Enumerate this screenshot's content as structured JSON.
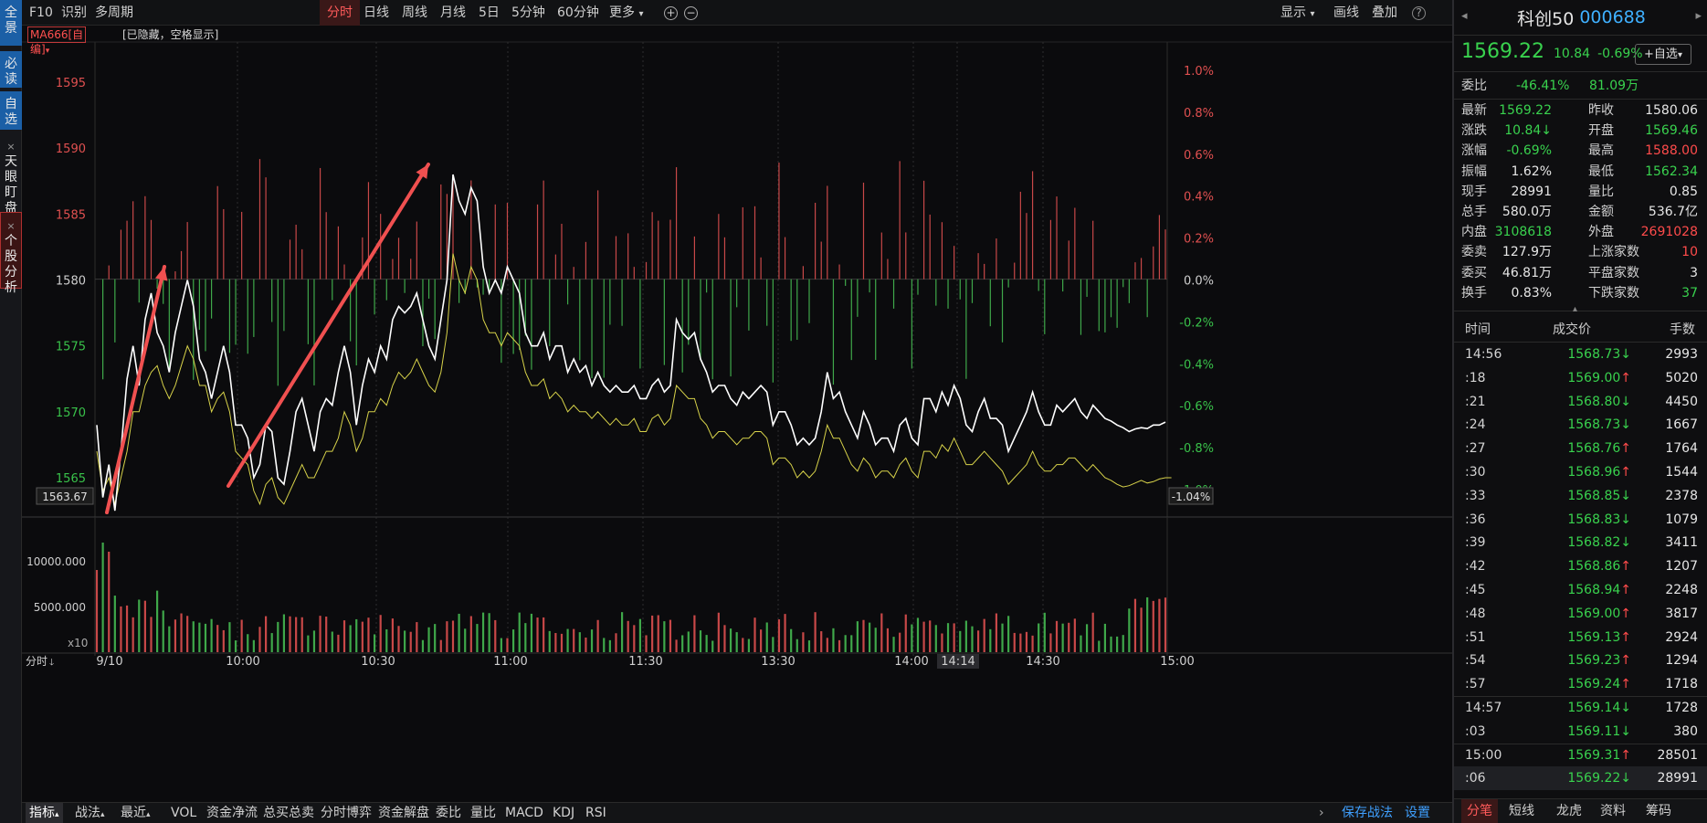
{
  "left_tabs": [
    {
      "label": "全景",
      "style": "blue"
    },
    {
      "label": "必读",
      "style": "blue"
    },
    {
      "label": "自选",
      "style": "blue"
    },
    {
      "label": "天眼盯盘",
      "style": "plain",
      "close": "×"
    },
    {
      "label": "个股分析",
      "style": "red",
      "close": "×"
    }
  ],
  "toolbar": {
    "f10": "F10",
    "identify": "识别",
    "multi_period": "多周期",
    "periods": [
      "分时",
      "日线",
      "周线",
      "月线",
      "5日",
      "5分钟",
      "60分钟"
    ],
    "more": "更多",
    "more_arrow": "▾",
    "zoom_in": "+",
    "zoom_out": "−",
    "display": "显示",
    "display_arrow": "▾",
    "draw_line": "画线",
    "overlay": "叠加",
    "help": "?"
  },
  "ma_bar": {
    "button": "MA666[自编]",
    "button_arrow": "▾",
    "hint": "[已隐藏，空格显示]"
  },
  "chart_data": {
    "type": "line",
    "yticks_price": [
      1595,
      1590,
      1585,
      1580,
      1575,
      1570,
      1565
    ],
    "yticks_pct": [
      "1.0%",
      "0.8%",
      "0.6%",
      "0.4%",
      "0.2%",
      "0.0%",
      "-0.2%",
      "-0.4%",
      "-0.6%",
      "-0.8%",
      "-1.0%"
    ],
    "price_cursor": "1563.67",
    "pct_cursor": "-1.04%",
    "xticks": [
      "9/10",
      "10:00",
      "10:30",
      "11:00",
      "11:30",
      "13:30",
      "14:00",
      "14:14",
      "14:30",
      "15:00"
    ],
    "volume_yticks": [
      "10000.000",
      "5000.000"
    ],
    "volume_unit": "x10",
    "period_label": "分时",
    "period_arrow": "🡓",
    "price_line": [
      1569,
      1563.5,
      1566,
      1562.5,
      1567,
      1572.5,
      1575,
      1572,
      1577,
      1579,
      1576,
      1575,
      1573,
      1576,
      1578,
      1580,
      1578,
      1574,
      1573,
      1571,
      1573,
      1575,
      1573,
      1569,
      1569,
      1568,
      1565,
      1566,
      1569,
      1568.5,
      1565,
      1564.5,
      1567,
      1570,
      1571,
      1569,
      1567,
      1570,
      1571,
      1570.5,
      1573,
      1575,
      1573,
      1569,
      1572,
      1574,
      1573,
      1575,
      1574,
      1577,
      1578,
      1577.5,
      1578,
      1579,
      1577,
      1575,
      1574,
      1577,
      1580,
      1588,
      1586,
      1585,
      1587,
      1586,
      1581,
      1579,
      1580,
      1579,
      1581,
      1580,
      1579,
      1576,
      1575,
      1575,
      1576,
      1574,
      1575,
      1575,
      1573,
      1574,
      1573,
      1573.5,
      1572,
      1573,
      1572,
      1571.5,
      1572,
      1571.5,
      1571.5,
      1572,
      1571,
      1571,
      1572,
      1572.5,
      1571.5,
      1572,
      1577,
      1576,
      1575.5,
      1576,
      1574,
      1573,
      1571.5,
      1572,
      1572,
      1571,
      1570.5,
      1571.5,
      1571,
      1571.5,
      1572,
      1571.5,
      1569,
      1570,
      1570,
      1569,
      1567.5,
      1568,
      1567.5,
      1568,
      1570,
      1573,
      1571,
      1571.5,
      1570,
      1569,
      1568,
      1570,
      1569,
      1567.5,
      1568,
      1568,
      1567,
      1569,
      1569.5,
      1568,
      1567.5,
      1571,
      1571,
      1570,
      1571.5,
      1570.5,
      1572,
      1571,
      1569,
      1568.5,
      1570,
      1571,
      1569.5,
      1569.5,
      1569,
      1567,
      1568,
      1569,
      1570,
      1571.5,
      1570,
      1569,
      1569,
      1570.5,
      1570,
      1570.5,
      1571,
      1570,
      1569.5,
      1570.5,
      1570,
      1569.5,
      1569.3,
      1569,
      1568.8,
      1568.5,
      1568.7,
      1568.8,
      1568.73,
      1569,
      1569,
      1569.22
    ],
    "avg_line": [
      1567,
      1564,
      1565,
      1563,
      1565,
      1567,
      1570,
      1570,
      1572,
      1573,
      1573.5,
      1572,
      1571,
      1572,
      1573.5,
      1575,
      1574,
      1572,
      1572,
      1570,
      1571,
      1571.5,
      1570,
      1567,
      1566.5,
      1566,
      1564,
      1563,
      1564.5,
      1565,
      1563.5,
      1563,
      1564,
      1565,
      1566,
      1565,
      1565,
      1566,
      1567,
      1567,
      1568,
      1570,
      1569,
      1567,
      1568,
      1570,
      1570,
      1571,
      1570.5,
      1572,
      1573,
      1572.5,
      1573,
      1574,
      1573,
      1572,
      1571.5,
      1573,
      1576,
      1582,
      1580,
      1579,
      1581,
      1580,
      1577,
      1576,
      1576,
      1575,
      1576,
      1575.5,
      1575,
      1573,
      1572,
      1572,
      1572.5,
      1571,
      1571.5,
      1571,
      1570,
      1570.5,
      1570,
      1570,
      1569.5,
      1570,
      1569.5,
      1569,
      1569.5,
      1569,
      1569,
      1569.5,
      1568.5,
      1568.5,
      1569.5,
      1569.8,
      1569,
      1569.5,
      1572,
      1571.5,
      1571,
      1571,
      1569.5,
      1569,
      1568,
      1568.5,
      1568.5,
      1568,
      1567.5,
      1568,
      1568,
      1568.5,
      1568.5,
      1568,
      1566,
      1566.5,
      1566.5,
      1566,
      1565,
      1565.5,
      1565,
      1565.5,
      1567,
      1569,
      1568,
      1568,
      1567,
      1566,
      1565.5,
      1566.5,
      1566,
      1565,
      1565.5,
      1565.5,
      1565,
      1566,
      1566.5,
      1565.5,
      1565,
      1567,
      1567,
      1566.5,
      1567.5,
      1567,
      1568,
      1567,
      1566,
      1566,
      1566.5,
      1567,
      1566.5,
      1566,
      1565.5,
      1564.5,
      1565,
      1565.5,
      1566,
      1567,
      1566,
      1565.5,
      1565.5,
      1566,
      1566,
      1566.5,
      1566.5,
      1566,
      1565.5,
      1566,
      1565.5,
      1565,
      1564.8,
      1564.5,
      1564.3,
      1564.4,
      1564.6,
      1564.8,
      1564.6,
      1564.7,
      1564.9,
      1565,
      1565
    ]
  },
  "right_panel": {
    "name": "科创50",
    "code": "000688",
    "prev_arrow": "◂",
    "next_arrow": "▸",
    "price": "1569.22",
    "change": "10.84",
    "pct": "-0.69%",
    "add_fav": "+自选",
    "fav_arrow": "▾",
    "weibi_label": "委比",
    "weibi_pct": "-46.41%",
    "weibi_val": "81.09万",
    "stats": [
      [
        "最新",
        "1569.22",
        "g",
        "昨收",
        "1580.06",
        "w"
      ],
      [
        "涨跌",
        "10.84↓",
        "g",
        "开盘",
        "1569.46",
        "g"
      ],
      [
        "涨幅",
        "-0.69%",
        "g",
        "最高",
        "1588.00",
        "r"
      ],
      [
        "振幅",
        "1.62%",
        "w",
        "最低",
        "1562.34",
        "g"
      ],
      [
        "现手",
        "28991",
        "w",
        "量比",
        "0.85",
        "w"
      ],
      [
        "总手",
        "580.0万",
        "w",
        "金额",
        "536.7亿",
        "w"
      ],
      [
        "内盘",
        "3108618",
        "g",
        "外盘",
        "2691028",
        "r"
      ],
      [
        "委卖",
        "127.9万",
        "w",
        "上涨家数",
        "10",
        "r"
      ],
      [
        "委买",
        "46.81万",
        "w",
        "平盘家数",
        "3",
        "w"
      ],
      [
        "换手",
        "0.83%",
        "w",
        "下跌家数",
        "37",
        "g"
      ]
    ],
    "collapse_arrow": "▴",
    "tick_headers": [
      "时间",
      "成交价",
      "手数"
    ],
    "ticks": [
      [
        "14:56",
        "1568.73",
        "↓",
        "2993"
      ],
      [
        ":18",
        "1569.00",
        "↑",
        "5020"
      ],
      [
        ":21",
        "1568.80",
        "↓",
        "4450"
      ],
      [
        ":24",
        "1568.73",
        "↓",
        "1667"
      ],
      [
        ":27",
        "1568.76",
        "↑",
        "1764"
      ],
      [
        ":30",
        "1568.96",
        "↑",
        "1544"
      ],
      [
        ":33",
        "1568.85",
        "↓",
        "2378"
      ],
      [
        ":36",
        "1568.83",
        "↓",
        "1079"
      ],
      [
        ":39",
        "1568.82",
        "↓",
        "3411"
      ],
      [
        ":42",
        "1568.86",
        "↑",
        "1207"
      ],
      [
        ":45",
        "1568.94",
        "↑",
        "2248"
      ],
      [
        ":48",
        "1569.00",
        "↑",
        "3817"
      ],
      [
        ":51",
        "1569.13",
        "↑",
        "2924"
      ],
      [
        ":54",
        "1569.23",
        "↑",
        "1294"
      ],
      [
        ":57",
        "1569.24",
        "↑",
        "1718"
      ],
      [
        "14:57",
        "1569.14",
        "↓",
        "1728"
      ],
      [
        ":03",
        "1569.11",
        "↓",
        "380"
      ],
      [
        "15:00",
        "1569.31",
        "↑",
        "28501"
      ],
      [
        ":06",
        "1569.22",
        "↓",
        "28991"
      ]
    ],
    "bottom_tabs": [
      "分笔",
      "短线",
      "龙虎",
      "资料",
      "筹码"
    ]
  },
  "bottom_tabs": {
    "indicator": "指标",
    "indicator_arrow": "▴",
    "tactics": "战法",
    "tactics_arrow": "▴",
    "recent": "最近",
    "recent_arrow": "▴",
    "items": [
      "VOL",
      "资金净流",
      "总买总卖",
      "分时博弈",
      "资金解盘",
      "委比",
      "量比",
      "MACD",
      "KDJ",
      "RSI"
    ],
    "right_arrow": "›",
    "save": "保存战法",
    "settings": "设置"
  },
  "colors": {
    "up": "#ff4b4b",
    "down": "#39d24e",
    "price_line": "#ffffff",
    "avg_line": "#d8d34a",
    "annotation": "#f05050",
    "accent_blue": "#3fb0ff"
  }
}
